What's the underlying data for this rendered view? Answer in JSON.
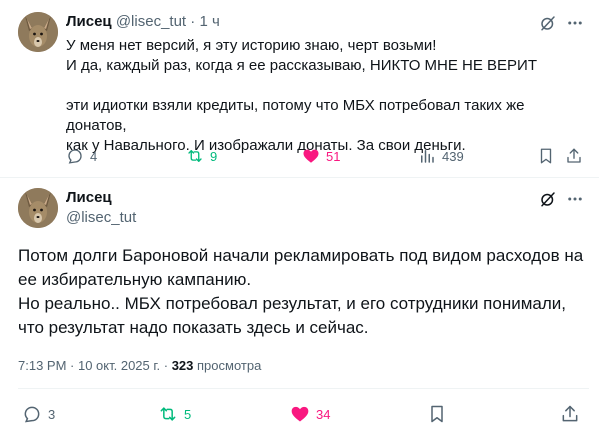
{
  "tweet1": {
    "author_name": "Лисец",
    "handle": "@lisec_tut",
    "separator": "·",
    "time": "1 ч",
    "lines": [
      "У меня нет версий, я эту историю знаю, черт возьми!",
      "И да, каждый раз, когда я ее рассказываю, НИКТО МНЕ НЕ ВЕРИТ",
      "",
      "эти идиотки взяли кредиты, потому что МБХ потребовал таких же донатов,",
      "как у Навального. И изображали донаты. За свои деньги."
    ],
    "actions": {
      "replies": "4",
      "reposts": "9",
      "likes": "51",
      "views": "439"
    }
  },
  "tweet2": {
    "author_name": "Лисец",
    "handle": "@lisec_tut",
    "lines": [
      "Потом долги Бароновой начали рекламировать под видом расходов на",
      "ее избирательную кампанию.",
      "Но реально.. МБХ потребовал результат, и его сотрудники понимали,",
      "что результат надо показать здесь и сейчас."
    ],
    "timestamp": "7:13 PM · 10 окт. 2025 г. · ",
    "views_count": "323",
    "views_label": " просмотра",
    "actions": {
      "replies": "3",
      "reposts": "5",
      "likes": "34"
    }
  },
  "icons": {
    "grok": "grok-icon",
    "more": "more-icon",
    "reply": "reply-icon",
    "repost": "repost-icon",
    "like": "heart-icon",
    "views": "views-icon",
    "bookmark": "bookmark-icon",
    "share": "share-icon"
  },
  "colors": {
    "text": "#0f1419",
    "secondary": "#536471",
    "repost": "#00ba7c",
    "like": "#f91880",
    "border": "#eff3f4"
  }
}
